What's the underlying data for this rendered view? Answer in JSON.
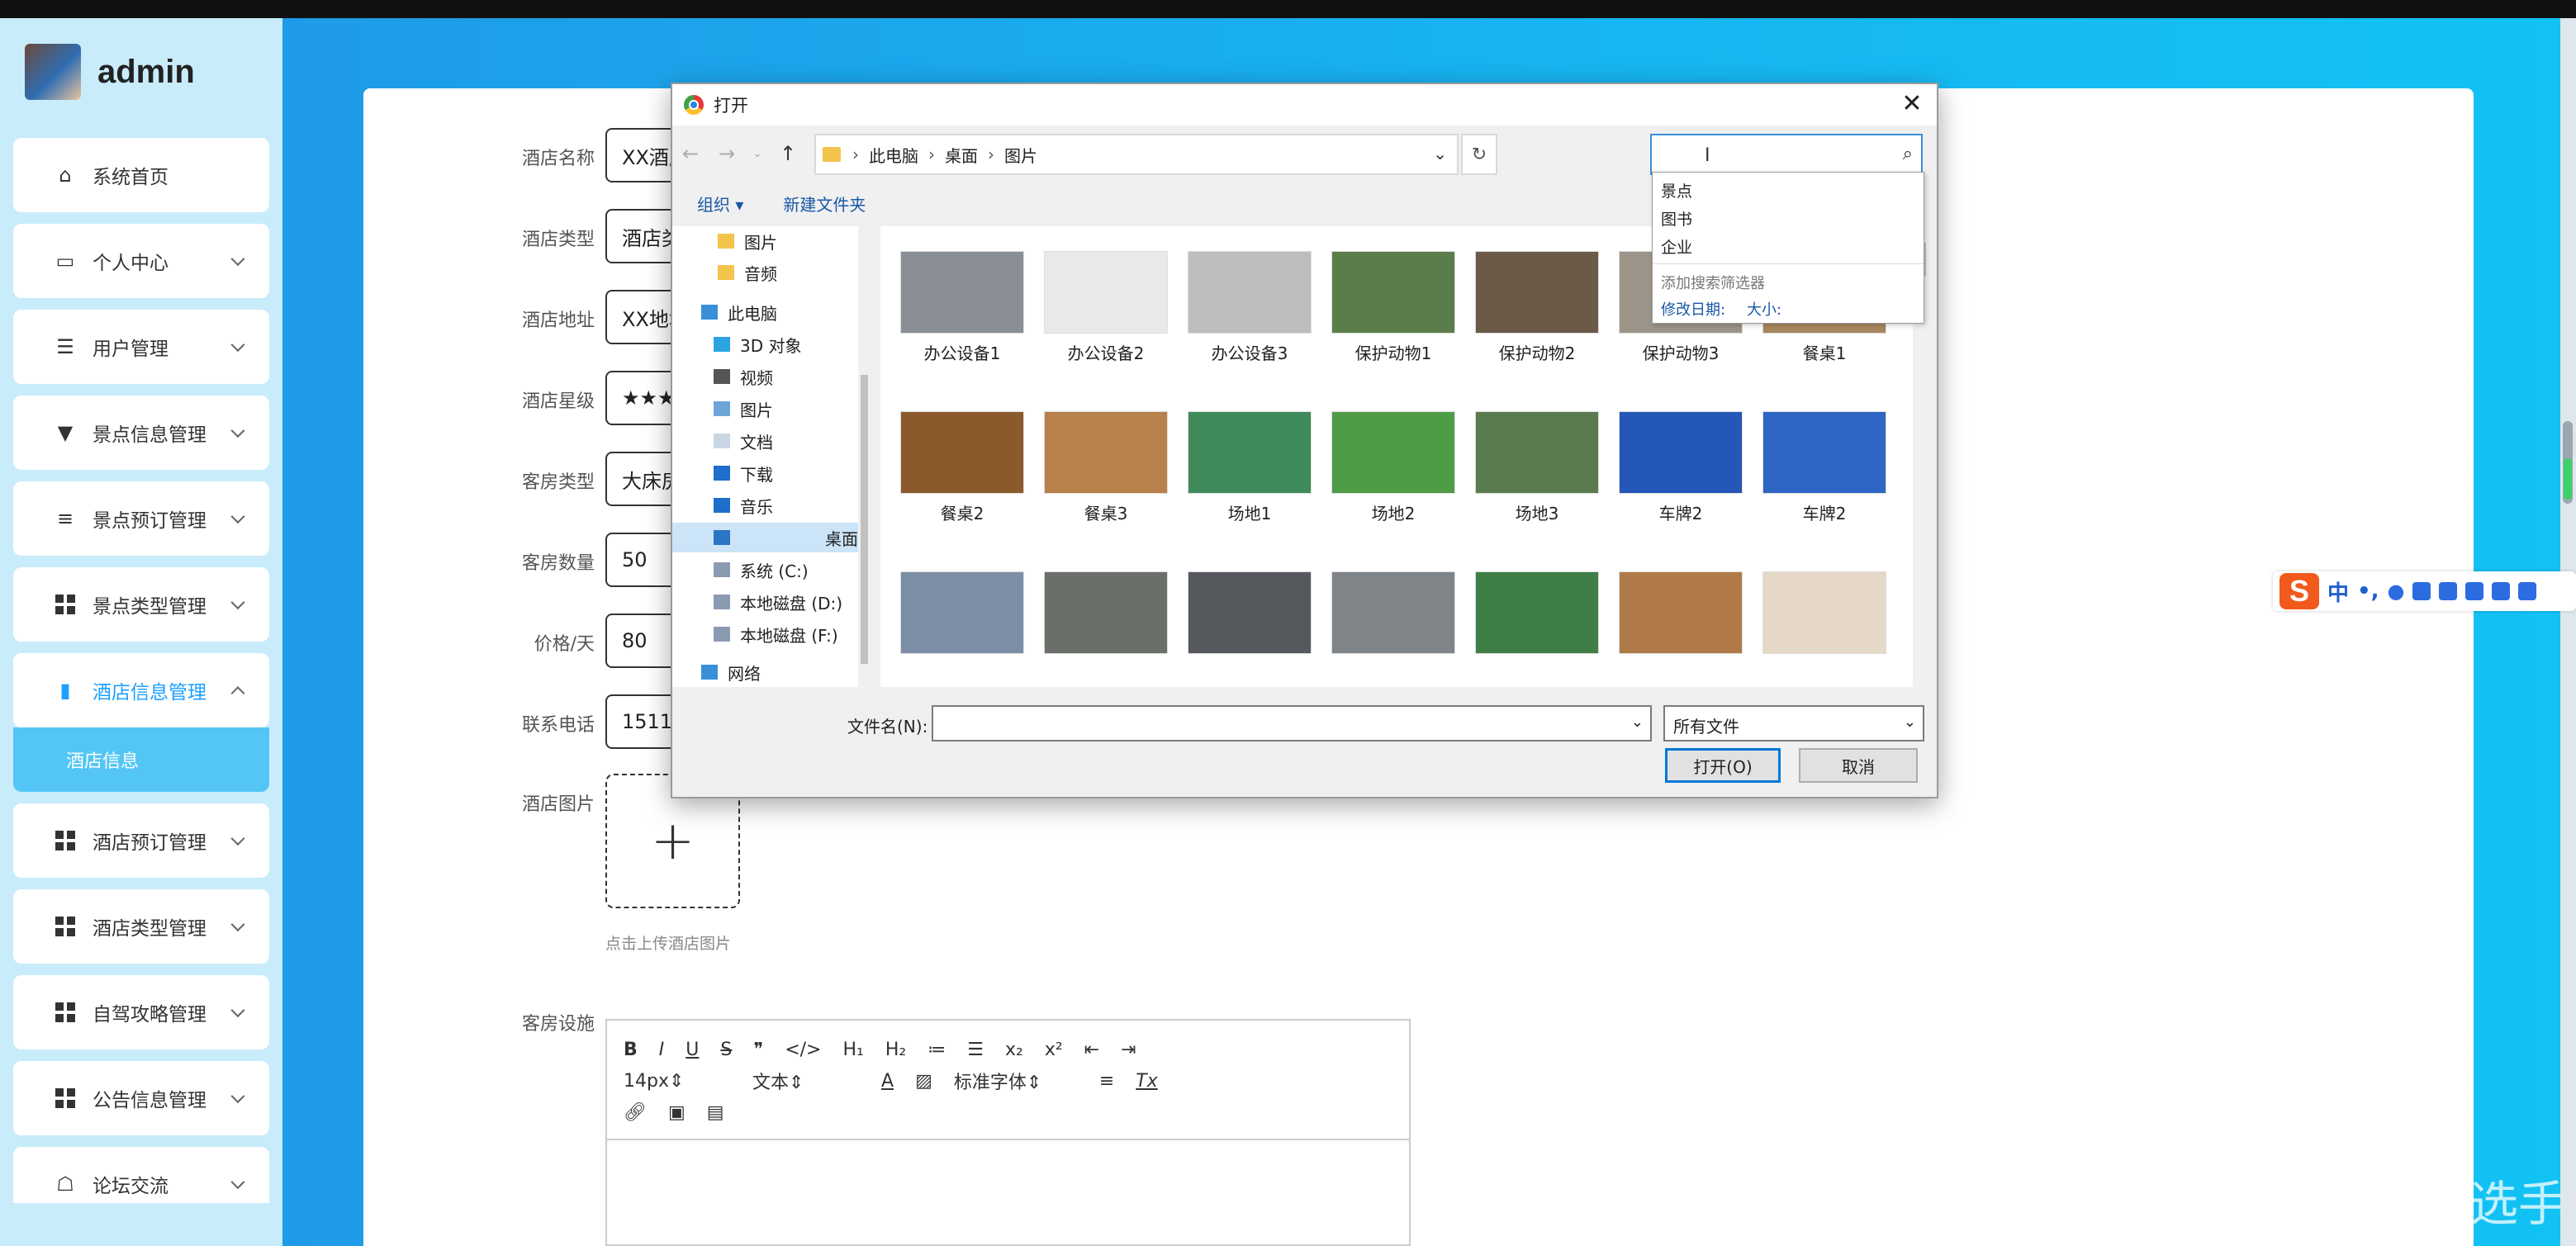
{
  "sidebar": {
    "username": "admin",
    "items": [
      {
        "label": "系统首页"
      },
      {
        "label": "个人中心"
      },
      {
        "label": "用户管理"
      },
      {
        "label": "景点信息管理"
      },
      {
        "label": "景点预订管理"
      },
      {
        "label": "景点类型管理"
      },
      {
        "label": "酒店信息管理"
      },
      {
        "label": "酒店预订管理"
      },
      {
        "label": "酒店类型管理"
      },
      {
        "label": "自驾攻略管理"
      },
      {
        "label": "公告信息管理"
      },
      {
        "label": "论坛交流"
      }
    ],
    "subitem": "酒店信息"
  },
  "form": {
    "fields": [
      {
        "label": "酒店名称",
        "value": "XX酒店"
      },
      {
        "label": "酒店类型",
        "value": "酒店类型"
      },
      {
        "label": "酒店地址",
        "value": "XX地址"
      },
      {
        "label": "酒店星级",
        "value": "★★★"
      },
      {
        "label": "客房类型",
        "value": "大床房"
      },
      {
        "label": "客房数量",
        "value": "50"
      },
      {
        "label": "价格/天",
        "value": "80"
      },
      {
        "label": "联系电话",
        "value": "15111"
      }
    ],
    "image_label": "酒店图片",
    "upload_plus": "+",
    "upload_hint": "点击上传酒店图片",
    "facility_label": "客房设施",
    "editor": {
      "row1": [
        "B",
        "I",
        "U",
        "S",
        "❞",
        "</>",
        "H₁",
        "H₂",
        "≔",
        "☰",
        "x₂",
        "x²",
        "⇤",
        "⇥"
      ],
      "font_size": "14px",
      "text_style": "文本",
      "font_family": "标准字体",
      "clear": "Tx"
    }
  },
  "dialog": {
    "title": "打开",
    "close": "✕",
    "breadcrumbs": [
      "此电脑",
      "桌面",
      "图片"
    ],
    "toolbar": {
      "organize": "组织 ▾",
      "new_folder": "新建文件夹"
    },
    "tree": [
      {
        "label": "图片",
        "icon": "folder"
      },
      {
        "label": "音频",
        "icon": "folder"
      },
      {
        "label": "此电脑",
        "icon": "pc"
      },
      {
        "label": "3D 对象",
        "icon": "cube"
      },
      {
        "label": "视频",
        "icon": "video"
      },
      {
        "label": "图片",
        "icon": "pictures"
      },
      {
        "label": "文档",
        "icon": "docs"
      },
      {
        "label": "下载",
        "icon": "download"
      },
      {
        "label": "音乐",
        "icon": "music"
      },
      {
        "label": "桌面",
        "icon": "desktop"
      },
      {
        "label": "系统 (C:)",
        "icon": "drive"
      },
      {
        "label": "本地磁盘 (D:)",
        "icon": "drive"
      },
      {
        "label": "本地磁盘 (F:)",
        "icon": "drive"
      },
      {
        "label": "网络",
        "icon": "network"
      }
    ],
    "files": [
      {
        "name": "办公设备1",
        "color": "#8a8f96"
      },
      {
        "name": "办公设备2",
        "color": "#e9e9e9"
      },
      {
        "name": "办公设备3",
        "color": "#bdbdbd"
      },
      {
        "name": "保护动物1",
        "color": "#5b7d4a"
      },
      {
        "name": "保护动物2",
        "color": "#6b5a48"
      },
      {
        "name": "保护动物3",
        "color": "#9c9488"
      },
      {
        "name": "餐桌1",
        "color": "#a6865e"
      },
      {
        "name": "餐桌2",
        "color": "#8b5a2b"
      },
      {
        "name": "餐桌3",
        "color": "#b8804a"
      },
      {
        "name": "场地1",
        "color": "#3f8a5a"
      },
      {
        "name": "场地2",
        "color": "#4f9c46"
      },
      {
        "name": "场地3",
        "color": "#5a7b4e"
      },
      {
        "name": "车牌2",
        "color": "#2457b8"
      },
      {
        "name": "车牌2",
        "color": "#2d66c4"
      },
      {
        "name": "",
        "color": "#7c8ea6"
      },
      {
        "name": "",
        "color": "#6a6f6a"
      },
      {
        "name": "",
        "color": "#55595e"
      },
      {
        "name": "",
        "color": "#7f8489"
      },
      {
        "name": "",
        "color": "#3f7f46"
      },
      {
        "name": "",
        "color": "#b07a48"
      },
      {
        "name": "",
        "color": "#e6d8c6"
      }
    ],
    "search_suggestions": [
      "景点",
      "图书",
      "企业"
    ],
    "search_filter_hint": "添加搜索筛选器",
    "filters": [
      "修改日期:",
      "大小:"
    ],
    "filename_label": "文件名(N):",
    "filetype": "所有文件",
    "open_button": "打开(O)",
    "cancel_button": "取消"
  },
  "ime": {
    "label": "中",
    "extra": "•,"
  },
  "watermark": "CSDN @JAVA编码选手",
  "colors": {
    "accent": "#1e9fff",
    "sidebar": "#c9ecfb",
    "main": "#17b6f2"
  }
}
